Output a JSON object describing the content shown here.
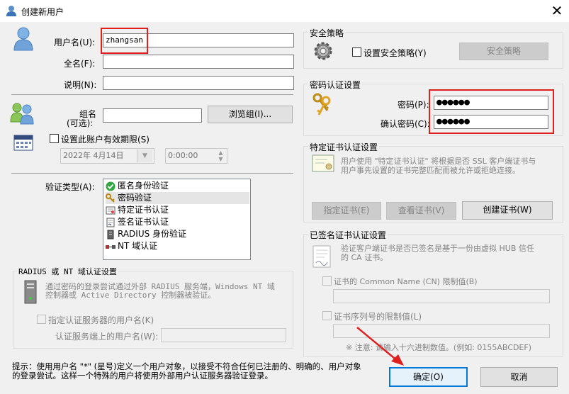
{
  "window": {
    "title": "创建新用户"
  },
  "user": {
    "username_label": "用户名(U):",
    "username_value": "zhangsan",
    "fullname_label": "全名(F):",
    "description_label": "说明(N):"
  },
  "group": {
    "label_line1": "组名",
    "label_line2": "(可选):",
    "browse_label": "浏览组(I)..."
  },
  "expiry": {
    "checkbox_label": "设置此账户有效期限(S)",
    "date_value": "2022年 4月14日",
    "time_value": "0:00:00"
  },
  "auth": {
    "label": "验证类型(A):",
    "items": [
      {
        "label": "匿名身份验证",
        "icon": "check-icon"
      },
      {
        "label": "密码验证",
        "icon": "key-icon"
      },
      {
        "label": "特定证书认证",
        "icon": "certificate-icon"
      },
      {
        "label": "签名证书认证",
        "icon": "signed-certificate-icon"
      },
      {
        "label": "RADIUS 身份验证",
        "icon": "server-icon"
      },
      {
        "label": "NT 域认证",
        "icon": "network-icon"
      }
    ]
  },
  "radius": {
    "group_title": "RADIUS 或 NT 域认证设置",
    "desc_line1": "通过密码的登录尝试通过外部 RADIUS 服务端，Windows NT 域",
    "desc_line2": "控制器或 Active Directory 控制器被验证。",
    "checkbox_label": "指定认证服务器的用户名(K)",
    "server_username_label": "认证服务端上的用户名(W):"
  },
  "hint": {
    "line1": "提示：使用用户名 \"*\" (星号)定义一个用户对象，以接受不符合任何已注册的、明确的、用户对象",
    "line2": "的登录尝试。这样一个特殊的用户将使用外部用户认证服务器验证登录。"
  },
  "security": {
    "group_title": "安全策略",
    "checkbox_label": "设置安全策略(Y)",
    "button_label": "安全策略"
  },
  "password": {
    "group_title": "密码认证设置",
    "password_label": "密码(P):",
    "confirm_label": "确认密码(C):",
    "password_mask": "●●●●●●",
    "confirm_mask": "●●●●●●"
  },
  "specific_cert": {
    "group_title": "特定证书认证设置",
    "desc_line1": "用户使用 \"特定证书认证\" 将根据是否 SSL 客户端证书与",
    "desc_line2": "用户事先设置的证书完整匹配而被允许或拒绝连接。",
    "specify_label": "指定证书(E)",
    "view_label": "查看证书(V)",
    "create_label": "创建证书(W)"
  },
  "signed_cert": {
    "group_title": "已签名证书认证设置",
    "desc_line1": "验证客户端证书是否已签名是基于一份由虚拟 HUB 信任",
    "desc_line2": "的 CA 证书。",
    "cn_label": "证书的 Common Name (CN) 限制值(B)",
    "serial_label": "证书序列号的限制值(L)",
    "note": "※ 注意: 请输入十六进制数值。(例如: 0155ABCDEF)"
  },
  "footer": {
    "ok_label": "确定(O)",
    "cancel_label": "取消"
  },
  "colors": {
    "highlight_red": "#e0201e",
    "focus_blue": "#0078d7",
    "dialog_bg": "#f0f0f0"
  }
}
